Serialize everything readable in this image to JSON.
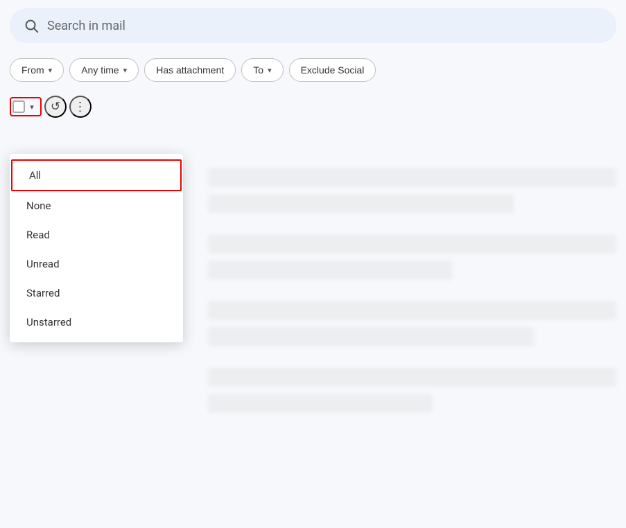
{
  "search": {
    "placeholder": "Search in mail"
  },
  "filters": {
    "from_label": "From",
    "time_label": "Any time",
    "attachment_label": "Has attachment",
    "to_label": "To",
    "exclude_label": "Exclude Social"
  },
  "toolbar": {
    "refresh_icon": "↺",
    "more_icon": "⋮",
    "chevron_down": "▾"
  },
  "dropdown": {
    "items": [
      {
        "label": "All",
        "selected": true
      },
      {
        "label": "None",
        "selected": false
      },
      {
        "label": "Read",
        "selected": false
      },
      {
        "label": "Unread",
        "selected": false
      },
      {
        "label": "Starred",
        "selected": false
      },
      {
        "label": "Unstarred",
        "selected": false
      }
    ]
  }
}
